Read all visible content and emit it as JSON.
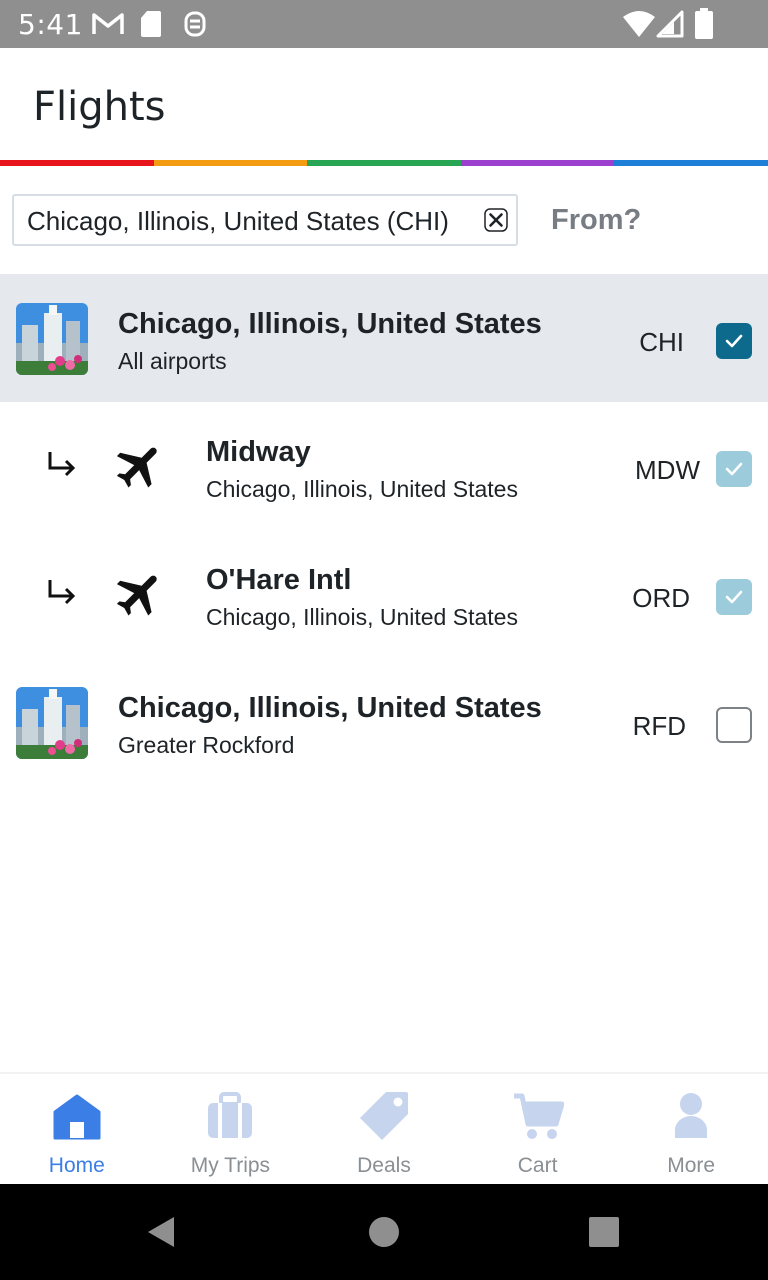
{
  "status_bar": {
    "time": "5:41",
    "left_icons": [
      "gmail-icon",
      "sd-card-icon",
      "sync-icon"
    ],
    "right_icons": [
      "wifi-icon",
      "cell-signal-icon",
      "battery-icon"
    ]
  },
  "header": {
    "title": "Flights",
    "rainbow_colors": [
      "#e8141b",
      "#f39c12",
      "#27a553",
      "#9b3fcf",
      "#1d7fd8"
    ]
  },
  "search": {
    "chip_text": "Chicago, Illinois, United States (CHI)",
    "from_label": "From?"
  },
  "results": [
    {
      "title": "Chicago, Illinois, United States",
      "subtitle": "All airports",
      "code": "CHI",
      "checked": true,
      "kind": "city"
    },
    {
      "title": "Midway",
      "subtitle": "Chicago, Illinois, United States",
      "code": "MDW",
      "checked": true,
      "kind": "airport"
    },
    {
      "title": "O'Hare Intl",
      "subtitle": "Chicago, Illinois, United States",
      "code": "ORD",
      "checked": true,
      "kind": "airport"
    },
    {
      "title": "Chicago, Illinois, United States",
      "subtitle": "Greater Rockford",
      "code": "RFD",
      "checked": false,
      "kind": "city"
    }
  ],
  "bottom_nav": {
    "items": [
      {
        "label": "Home",
        "icon": "home-icon",
        "active": true
      },
      {
        "label": "My Trips",
        "icon": "suitcase-icon",
        "active": false
      },
      {
        "label": "Deals",
        "icon": "tag-icon",
        "active": false
      },
      {
        "label": "Cart",
        "icon": "cart-icon",
        "active": false
      },
      {
        "label": "More",
        "icon": "person-icon",
        "active": false
      }
    ],
    "active_color": "#3b7ee6",
    "inactive_icon_color": "#c6d4ee"
  },
  "android_nav": [
    "back-icon",
    "home-circle-icon",
    "recents-icon"
  ]
}
